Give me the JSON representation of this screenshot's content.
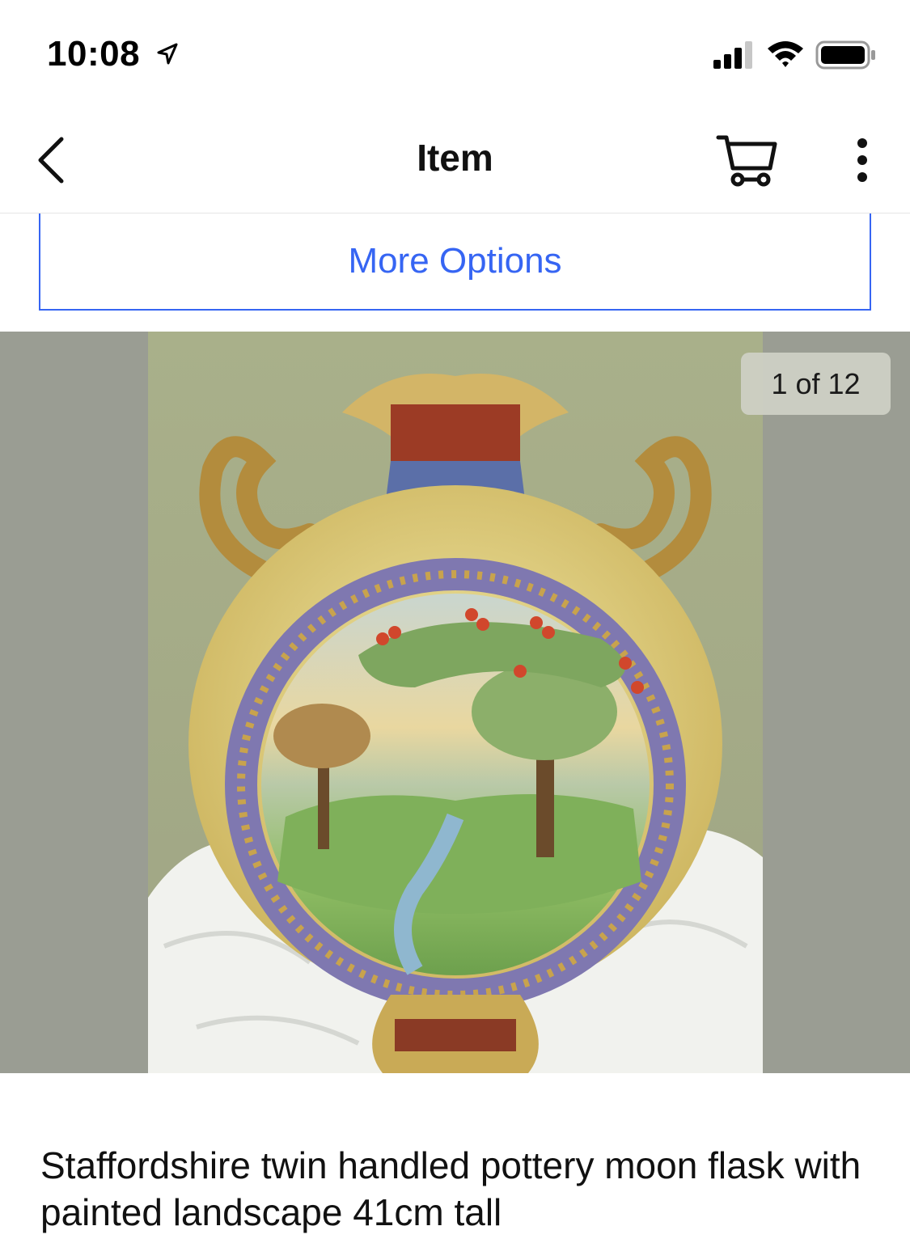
{
  "status_bar": {
    "time": "10:08",
    "icons": [
      "location-arrow-icon",
      "cellular-signal-icon",
      "wifi-icon",
      "battery-icon"
    ]
  },
  "nav": {
    "title": "Item",
    "back_icon": "chevron-left-icon",
    "cart_icon": "shopping-cart-icon",
    "more_icon": "vertical-ellipsis-icon"
  },
  "options": {
    "more_options_label": "More Options"
  },
  "gallery": {
    "counter": "1 of 12",
    "current_index": 1,
    "total": 12
  },
  "item": {
    "title": "Staffordshire twin handled pottery moon flask with painted landscape 41cm tall"
  },
  "colors": {
    "accent_blue": "#3665f3",
    "gallery_background": "#9a9d93",
    "counter_background": "#cdd0c4"
  }
}
